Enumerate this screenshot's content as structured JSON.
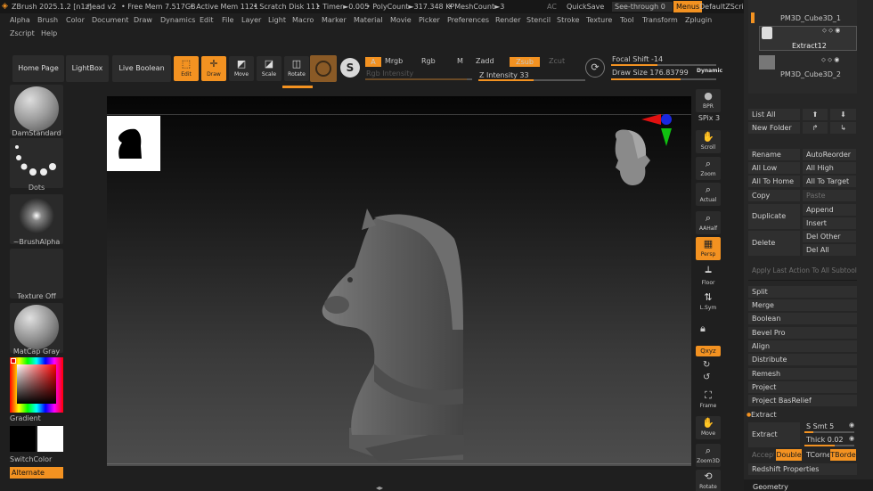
{
  "titlebar": {
    "app": "ZBrush 2025.1.2 [n1z]",
    "doc": "head v2",
    "free_mem": "• Free Mem 7.517GB",
    "active_mem": "• Active Mem 1121",
    "scratch": "• Scratch Disk 111",
    "timer": "• Timer►0.005",
    "polycount": "• PolyCount►317.348 KP",
    "meshcount": "• MeshCount►3",
    "ac": "AC",
    "quicksave": "QuickSave",
    "seethrough": "See-through   0",
    "menus": "Menus",
    "script": "DefaultZScript"
  },
  "menu_row1": [
    "Alpha",
    "Brush",
    "Color",
    "Document",
    "Draw",
    "Dynamics",
    "Edit",
    "File",
    "Layer",
    "Light",
    "Macro",
    "Marker",
    "Material",
    "Movie",
    "Picker",
    "Preferences",
    "Render",
    "Stencil",
    "Stroke",
    "Texture",
    "Tool",
    "Transform",
    "Zplugin"
  ],
  "menu_row2": [
    "Zscript",
    "Help"
  ],
  "shelf": {
    "home": "Home Page",
    "lightbox": "LightBox",
    "liveboolean": "Live Boolean",
    "edit": "Edit",
    "draw": "Draw",
    "move": "Move",
    "scale": "Scale",
    "rotate": "Rotate",
    "a": "A",
    "mrgb": "Mrgb",
    "rgb": "Rgb",
    "m": "M",
    "zadd": "Zadd",
    "zsub": "Zsub",
    "zcut": "Zcut",
    "rgb_intensity": "Rgb Intensity",
    "z_intensity": "Z Intensity 33",
    "focal_shift": "Focal Shift -14",
    "draw_size": "Draw Size 176.83799",
    "dynamic": "Dynamic"
  },
  "left": {
    "brush": "DamStandard",
    "stroke": "Dots",
    "alpha": "~BrushAlpha",
    "texture": "Texture Off",
    "material": "MatCap Gray",
    "gradient": "Gradient",
    "switchcolor": "SwitchColor",
    "alternate": "Alternate"
  },
  "righttools": [
    {
      "name": "bpr",
      "label": "BPR"
    },
    {
      "name": "spix",
      "label": "SPix 3"
    },
    {
      "name": "scroll",
      "label": "Scroll"
    },
    {
      "name": "zoom",
      "label": "Zoom"
    },
    {
      "name": "actual",
      "label": "Actual"
    },
    {
      "name": "aahalf",
      "label": "AAHalf"
    },
    {
      "name": "persp",
      "label": "Persp"
    },
    {
      "name": "floor",
      "label": "Floor"
    },
    {
      "name": "lsym",
      "label": "L.Sym"
    },
    {
      "name": "xyz",
      "label": "Qxyz"
    },
    {
      "name": "frame",
      "label": "Frame"
    },
    {
      "name": "move",
      "label": "Move"
    },
    {
      "name": "zoom3d",
      "label": "Zoom3D"
    },
    {
      "name": "rotate",
      "label": "Rotate"
    }
  ],
  "rightpanel": {
    "sub1": "PM3D_Cube3D_1",
    "sub2": "Extract12",
    "sub3": "PM3D_Cube3D_2",
    "list_all": "List All",
    "new_folder": "New Folder",
    "rename": "Rename",
    "autoreorder": "AutoReorder",
    "all_low": "All Low",
    "all_high": "All High",
    "all_to_home": "All To Home",
    "all_to_target": "All To Target",
    "copy": "Copy",
    "paste": "Paste",
    "duplicate": "Duplicate",
    "append": "Append",
    "insert": "Insert",
    "delete": "Delete",
    "del_other": "Del Other",
    "del_all": "Del All",
    "apply_last": "Apply Last Action To All Subtools",
    "split": "Split",
    "merge": "Merge",
    "boolean": "Boolean",
    "bevel_pro": "Bevel Pro",
    "align": "Align",
    "distribute": "Distribute",
    "remesh": "Remesh",
    "project": "Project",
    "project_basrelief": "Project BasRelief",
    "extract_header": "Extract",
    "extract": "Extract",
    "s_smt": "S Smt 5",
    "thick": "Thick 0.02",
    "accept": "Accept",
    "double": "Double",
    "tcorne": "TCorne",
    "tborde": "TBorde",
    "redshift": "Redshift Properties",
    "geometry": "Geometry"
  },
  "colors": {
    "accent": "#f39221",
    "background": "#1f1f1f",
    "panel": "#262626"
  }
}
